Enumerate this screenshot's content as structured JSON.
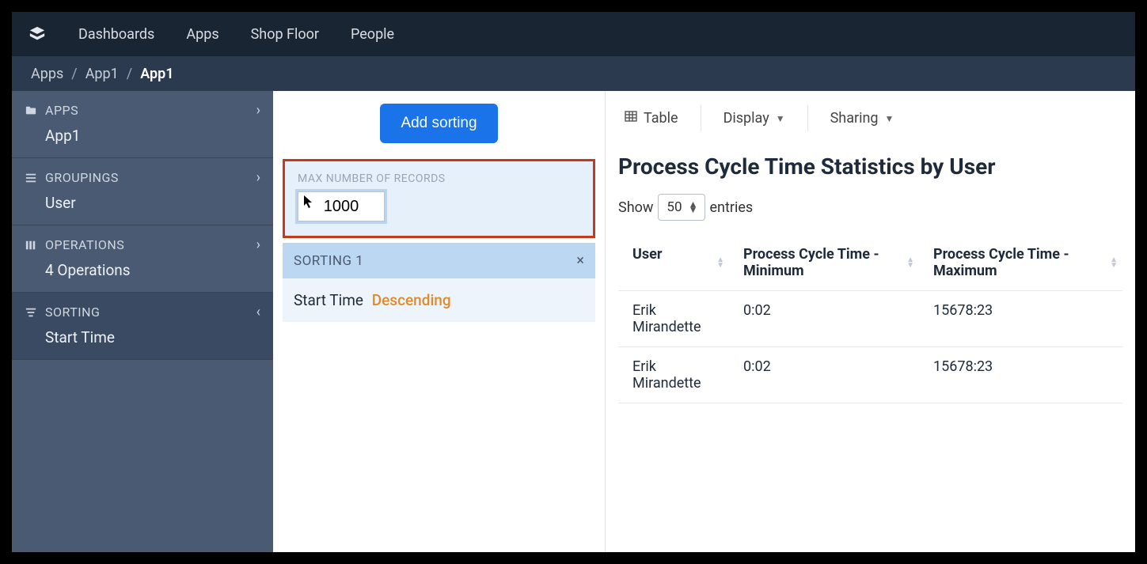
{
  "nav": {
    "items": [
      "Dashboards",
      "Apps",
      "Shop Floor",
      "People"
    ]
  },
  "breadcrumb": {
    "items": [
      "Apps",
      "App1",
      "App1"
    ]
  },
  "sidebar": {
    "sections": [
      {
        "title": "APPS",
        "sub": "App1",
        "expanded": false
      },
      {
        "title": "GROUPINGS",
        "sub": "User",
        "expanded": false
      },
      {
        "title": "OPERATIONS",
        "sub": "4 Operations",
        "expanded": false
      },
      {
        "title": "SORTING",
        "sub": "Start Time",
        "expanded": true
      }
    ]
  },
  "config": {
    "add_sorting_label": "Add sorting",
    "max_records_label": "MAX NUMBER OF RECORDS",
    "max_records_value": "1000",
    "sorting_header": "SORTING 1",
    "sorting_field": "Start Time",
    "sorting_direction": "Descending"
  },
  "toolbar": {
    "table_label": "Table",
    "display_label": "Display",
    "sharing_label": "Sharing"
  },
  "content": {
    "title": "Process Cycle Time Statistics by User",
    "show_prefix": "Show",
    "show_value": "50",
    "show_suffix": "entries",
    "columns": [
      "User",
      "Process Cycle Time - Minimum",
      "Process Cycle Time - Maximum"
    ],
    "rows": [
      {
        "user": "Erik Mirandette",
        "min": "0:02",
        "max": "15678:23"
      },
      {
        "user": "Erik Mirandette",
        "min": "0:02",
        "max": "15678:23"
      }
    ]
  }
}
